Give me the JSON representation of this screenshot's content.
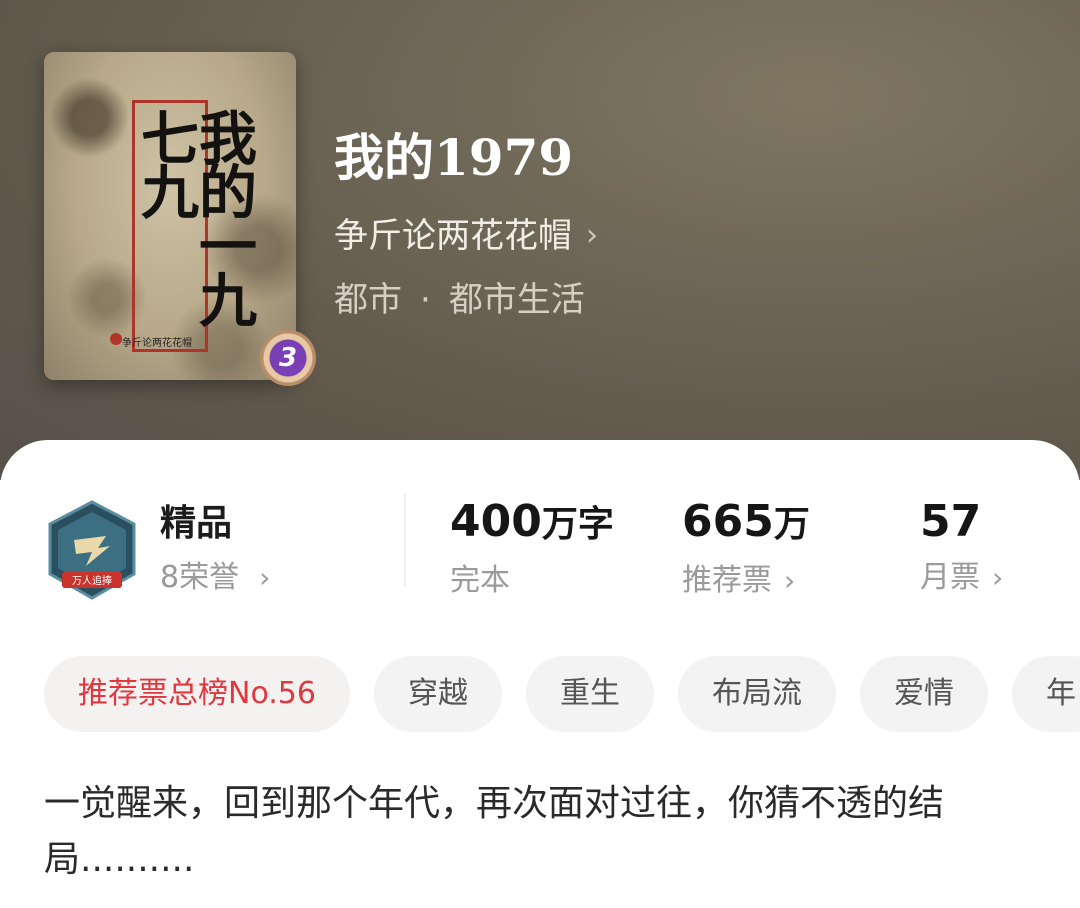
{
  "book": {
    "title": "我的1979",
    "author": "争斤论两花花帽",
    "genre": "都市",
    "subgenre": "都市生活",
    "cover_title": "我的一九七九",
    "cover_author": "争斤论两花花帽",
    "level": "3"
  },
  "honor": {
    "title": "精品",
    "subtitle": "8荣誉",
    "emblem_text": "万人追捧"
  },
  "stats": {
    "words": {
      "number": "400",
      "unit": "万字",
      "label": "完本"
    },
    "recommend": {
      "number": "665",
      "unit": "万",
      "label": "推荐票"
    },
    "monthly": {
      "number": "57",
      "unit": "",
      "label": "月票"
    }
  },
  "tags": [
    {
      "label": "推荐票总榜No.56"
    },
    {
      "label": "穿越"
    },
    {
      "label": "重生"
    },
    {
      "label": "布局流"
    },
    {
      "label": "爱情"
    },
    {
      "label": "年"
    }
  ],
  "description": "一觉醒来，回到那个年代，再次面对过往，你猜不透的结局..........",
  "icons": {
    "chevron": "chevron-right-icon",
    "separator": "·"
  },
  "colors": {
    "accent_red": "#e0383e",
    "level_badge": "#7a3fb5"
  }
}
